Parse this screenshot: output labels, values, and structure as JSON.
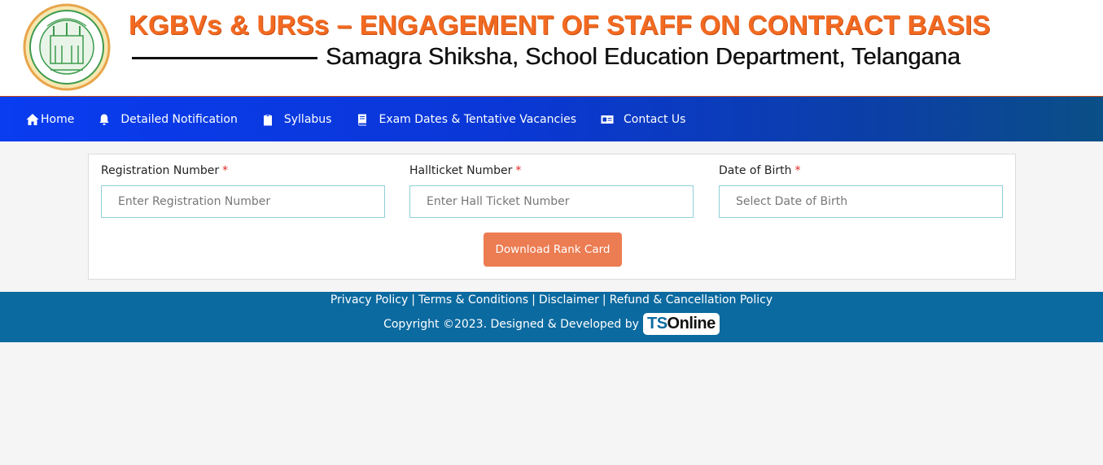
{
  "header": {
    "title": "KGBVs & URSs – ENGAGEMENT OF STAFF ON CONTRACT BASIS",
    "subtitle": "Samagra Shiksha, School Education Department, Telangana",
    "emblem_icon": "telangana-government-emblem"
  },
  "nav": {
    "items": [
      {
        "label": "Home",
        "icon": "home-icon"
      },
      {
        "label": "Detailed Notification",
        "icon": "bell-icon"
      },
      {
        "label": "Syllabus",
        "icon": "clipboard-icon"
      },
      {
        "label": "Exam Dates & Tentative Vacancies",
        "icon": "book-icon"
      },
      {
        "label": "Contact Us",
        "icon": "id-card-icon"
      }
    ]
  },
  "form": {
    "registration": {
      "label": "Registration Number",
      "placeholder": "Enter Registration Number",
      "value": ""
    },
    "hallticket": {
      "label": "Hallticket Number",
      "placeholder": "Enter Hall Ticket Number",
      "value": ""
    },
    "dob": {
      "label": "Date of Birth",
      "placeholder": "Select Date of Birth",
      "value": ""
    },
    "required_mark": "*",
    "submit_label": "Download Rank Card"
  },
  "footer": {
    "links": [
      "Privacy Policy",
      "Terms & Conditions",
      "Disclaimer",
      "Refund & Cancellation Policy"
    ],
    "separator": "|",
    "copyright": "Copyright ©2023. Designed & Developed by",
    "logo_ts": "TS",
    "logo_online": "Online"
  },
  "colors": {
    "title_orange": "#f26a21",
    "nav_blue": "#0a3cf0",
    "button_orange": "#ec7c52",
    "footer_blue": "#0b6aa0",
    "input_border": "#8fcfd8",
    "required_red": "#e0281e"
  }
}
